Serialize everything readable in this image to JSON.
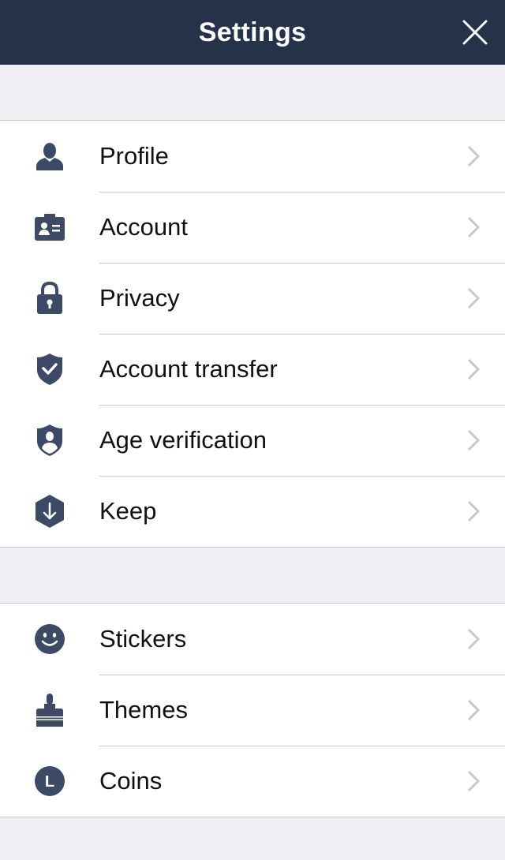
{
  "header": {
    "title": "Settings",
    "close_icon": "close-icon"
  },
  "colors": {
    "navbar": "#263249",
    "icon": "#3d4a66",
    "chevron": "#c7c7cc",
    "background": "#efeff4"
  },
  "groups": [
    {
      "items": [
        {
          "label": "Profile",
          "icon": "person-icon"
        },
        {
          "label": "Account",
          "icon": "id-card-icon"
        },
        {
          "label": "Privacy",
          "icon": "lock-icon"
        },
        {
          "label": "Account transfer",
          "icon": "shield-check-icon"
        },
        {
          "label": "Age verification",
          "icon": "shield-person-icon"
        },
        {
          "label": "Keep",
          "icon": "hexagon-download-icon"
        }
      ]
    },
    {
      "items": [
        {
          "label": "Stickers",
          "icon": "smiley-icon"
        },
        {
          "label": "Themes",
          "icon": "paintbrush-icon"
        },
        {
          "label": "Coins",
          "icon": "coin-icon",
          "icon_text": "L"
        }
      ]
    }
  ]
}
